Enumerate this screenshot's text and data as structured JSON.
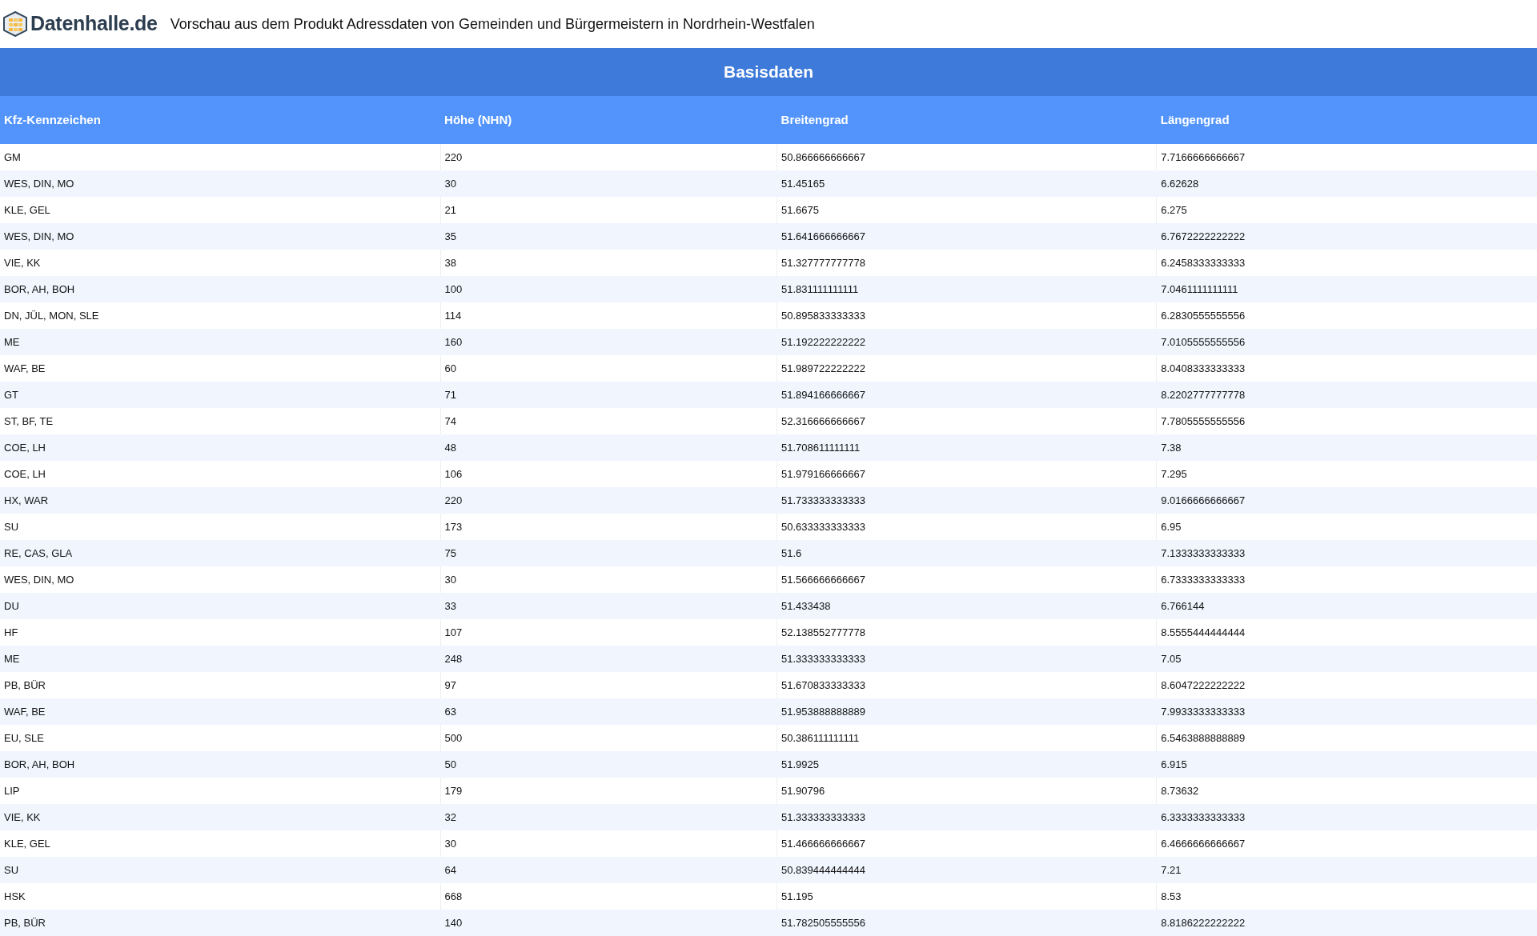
{
  "header": {
    "logo_text": "Datenhalle.de",
    "title": "Vorschau aus dem Produkt Adressdaten von Gemeinden und Bürgermeistern in Nordrhein-Westfalen"
  },
  "table": {
    "group_title": "Basisdaten",
    "columns": [
      "Kfz-Kennzeichen",
      "Höhe (NHN)",
      "Breitengrad",
      "Längengrad"
    ],
    "rows": [
      [
        "GM",
        "220",
        "50.866666666667",
        "7.7166666666667"
      ],
      [
        "WES, DIN, MO",
        "30",
        "51.45165",
        "6.62628"
      ],
      [
        "KLE, GEL",
        "21",
        "51.6675",
        "6.275"
      ],
      [
        "WES, DIN, MO",
        "35",
        "51.641666666667",
        "6.7672222222222"
      ],
      [
        "VIE, KK",
        "38",
        "51.327777777778",
        "6.2458333333333"
      ],
      [
        "BOR, AH, BOH",
        "100",
        "51.831111111111",
        "7.0461111111111"
      ],
      [
        "DN, JÜL, MON, SLE",
        "114",
        "50.895833333333",
        "6.2830555555556"
      ],
      [
        "ME",
        "160",
        "51.192222222222",
        "7.0105555555556"
      ],
      [
        "WAF, BE",
        "60",
        "51.989722222222",
        "8.0408333333333"
      ],
      [
        "GT",
        "71",
        "51.894166666667",
        "8.2202777777778"
      ],
      [
        "ST, BF, TE",
        "74",
        "52.316666666667",
        "7.7805555555556"
      ],
      [
        "COE, LH",
        "48",
        "51.708611111111",
        "7.38"
      ],
      [
        "COE, LH",
        "106",
        "51.979166666667",
        "7.295"
      ],
      [
        "HX, WAR",
        "220",
        "51.733333333333",
        "9.0166666666667"
      ],
      [
        "SU",
        "173",
        "50.633333333333",
        "6.95"
      ],
      [
        "RE, CAS, GLA",
        "75",
        "51.6",
        "7.1333333333333"
      ],
      [
        "WES, DIN, MO",
        "30",
        "51.566666666667",
        "6.7333333333333"
      ],
      [
        "DU",
        "33",
        "51.433438",
        "6.766144"
      ],
      [
        "HF",
        "107",
        "52.138552777778",
        "8.5555444444444"
      ],
      [
        "ME",
        "248",
        "51.333333333333",
        "7.05"
      ],
      [
        "PB, BÜR",
        "97",
        "51.670833333333",
        "8.6047222222222"
      ],
      [
        "WAF, BE",
        "63",
        "51.953888888889",
        "7.9933333333333"
      ],
      [
        "EU, SLE",
        "500",
        "50.386111111111",
        "6.5463888888889"
      ],
      [
        "BOR, AH, BOH",
        "50",
        "51.9925",
        "6.915"
      ],
      [
        "LIP",
        "179",
        "51.90796",
        "8.73632"
      ],
      [
        "VIE, KK",
        "32",
        "51.333333333333",
        "6.3333333333333"
      ],
      [
        "KLE, GEL",
        "30",
        "51.466666666667",
        "6.4666666666667"
      ],
      [
        "SU",
        "64",
        "50.839444444444",
        "7.21"
      ],
      [
        "HSK",
        "668",
        "51.195",
        "8.53"
      ],
      [
        "PB, BÜR",
        "140",
        "51.782505555556",
        "8.8186222222222"
      ]
    ]
  }
}
